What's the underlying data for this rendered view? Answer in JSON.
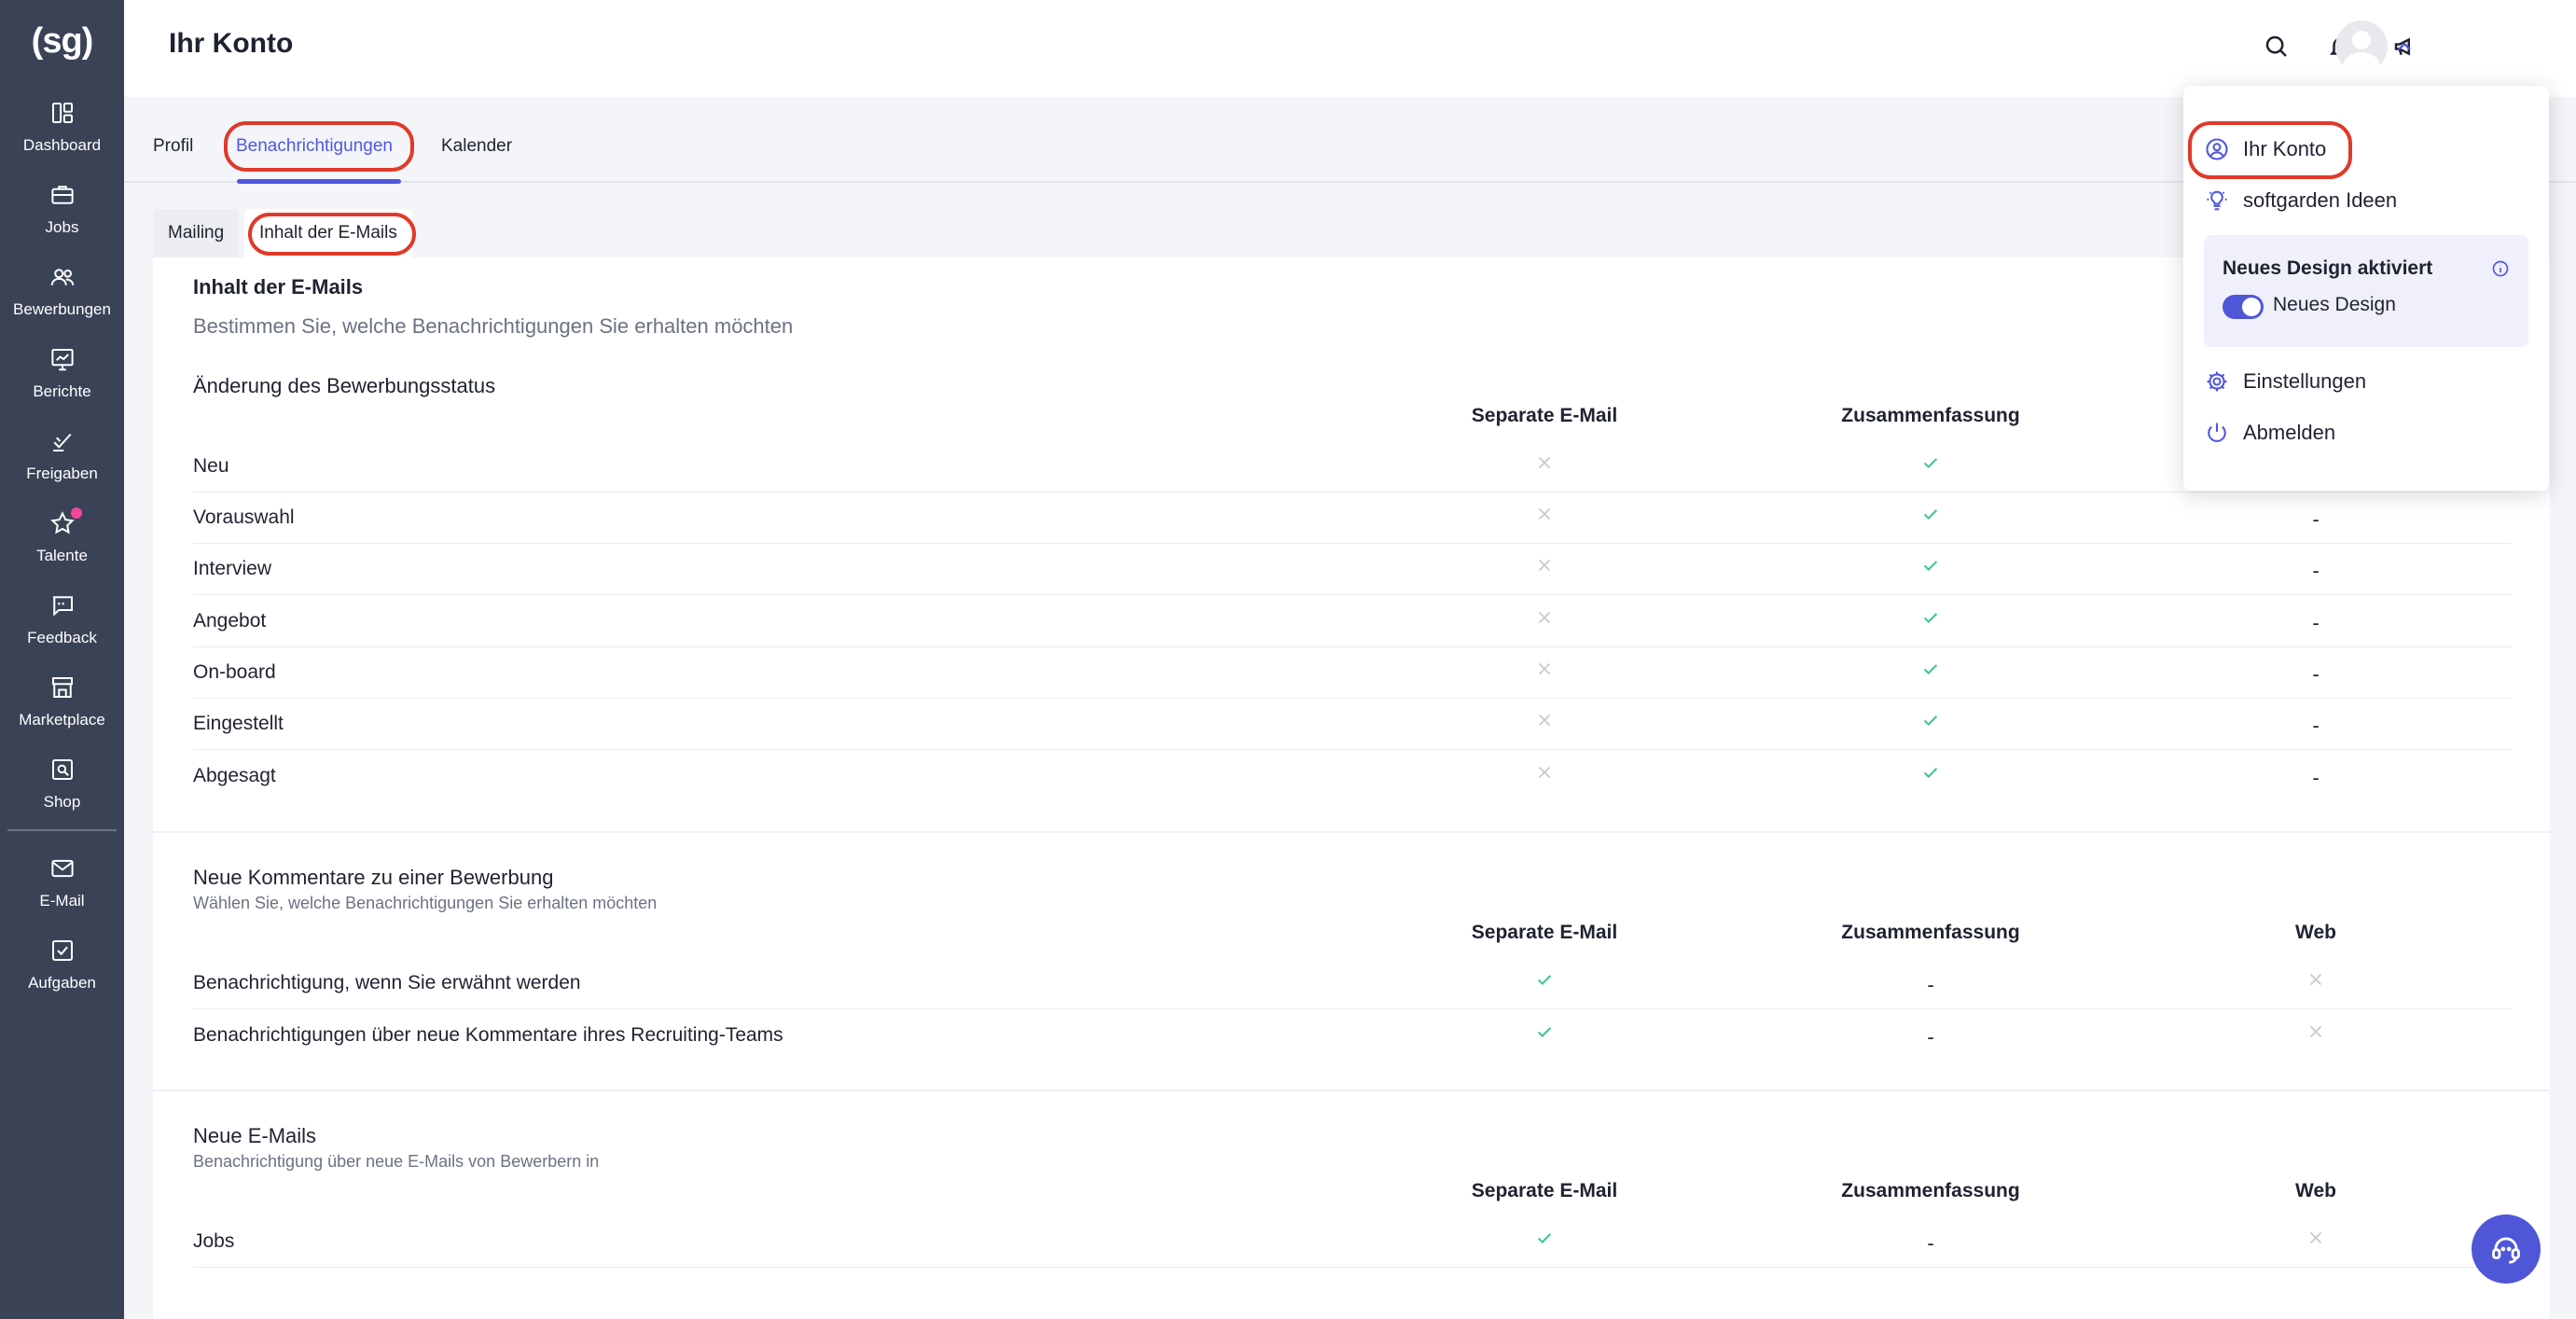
{
  "app": {
    "logo": "(sg)"
  },
  "sidebar": {
    "items": [
      {
        "label": "Dashboard",
        "icon": "dashboard-icon"
      },
      {
        "label": "Jobs",
        "icon": "briefcase-icon"
      },
      {
        "label": "Bewerbungen",
        "icon": "people-icon"
      },
      {
        "label": "Berichte",
        "icon": "chart-icon"
      },
      {
        "label": "Freigaben",
        "icon": "approval-icon"
      },
      {
        "label": "Talente",
        "icon": "star-icon"
      },
      {
        "label": "Feedback",
        "icon": "feedback-icon"
      },
      {
        "label": "Marketplace",
        "icon": "store-icon"
      },
      {
        "label": "Shop",
        "icon": "shop-icon"
      },
      {
        "label": "E-Mail",
        "icon": "mail-icon"
      },
      {
        "label": "Aufgaben",
        "icon": "tasks-icon"
      }
    ]
  },
  "header": {
    "title": "Ihr Konto"
  },
  "tabs": [
    {
      "label": "Profil"
    },
    {
      "label": "Benachrichtigungen"
    },
    {
      "label": "Kalender"
    }
  ],
  "subtabs": [
    {
      "label": "Mailing"
    },
    {
      "label": "Inhalt der E-Mails"
    }
  ],
  "content": {
    "title": "Inhalt der E-Mails",
    "description": "Bestimmen Sie, welche Benachrichtigungen Sie erhalten möchten",
    "sections": [
      {
        "title": "Änderung des Bewerbungsstatus",
        "columns": [
          "Separate E-Mail",
          "Zusammenfassung"
        ],
        "rows": [
          {
            "label": "Neu",
            "values": [
              "x",
              "check",
              "-"
            ]
          },
          {
            "label": "Vorauswahl",
            "values": [
              "x",
              "check",
              "-"
            ]
          },
          {
            "label": "Interview",
            "values": [
              "x",
              "check",
              "-"
            ]
          },
          {
            "label": "Angebot",
            "values": [
              "x",
              "check",
              "-"
            ]
          },
          {
            "label": "On-board",
            "values": [
              "x",
              "check",
              "-"
            ]
          },
          {
            "label": "Eingestellt",
            "values": [
              "x",
              "check",
              "-"
            ]
          },
          {
            "label": "Abgesagt",
            "values": [
              "x",
              "check",
              "-"
            ]
          }
        ]
      },
      {
        "title": "Neue Kommentare zu einer Bewerbung",
        "subtitle": "Wählen Sie, welche Benachrichtigungen Sie erhalten möchten",
        "columns": [
          "Separate E-Mail",
          "Zusammenfassung",
          "Web"
        ],
        "rows": [
          {
            "label": "Benachrichtigung, wenn Sie erwähnt werden",
            "values": [
              "check",
              "-",
              "x"
            ]
          },
          {
            "label": "Benachrichtigungen über neue Kommentare ihres Recruiting-Teams",
            "values": [
              "check",
              "-",
              "x"
            ]
          }
        ]
      },
      {
        "title": "Neue E-Mails",
        "subtitle": "Benachrichtigung über neue E-Mails von Bewerbern in",
        "columns": [
          "Separate E-Mail",
          "Zusammenfassung",
          "Web"
        ],
        "rows": [
          {
            "label": "Jobs",
            "values": [
              "check",
              "-",
              "x"
            ]
          }
        ]
      }
    ]
  },
  "dropdown": {
    "items": [
      {
        "label": "Ihr Konto",
        "icon": "account-icon"
      },
      {
        "label": "softgarden Ideen",
        "icon": "lightbulb-icon"
      }
    ],
    "design_card": {
      "title": "Neues Design aktiviert",
      "toggle_label": "Neues Design",
      "toggle_on": true
    },
    "bottom_items": [
      {
        "label": "Einstellungen",
        "icon": "gear-icon"
      },
      {
        "label": "Abmelden",
        "icon": "power-icon"
      }
    ]
  },
  "colors": {
    "sidebar": "#3a4256",
    "accent": "#5057e0",
    "check": "#3cc496",
    "cross": "#c7cad1",
    "highlight": "#e0392b"
  }
}
